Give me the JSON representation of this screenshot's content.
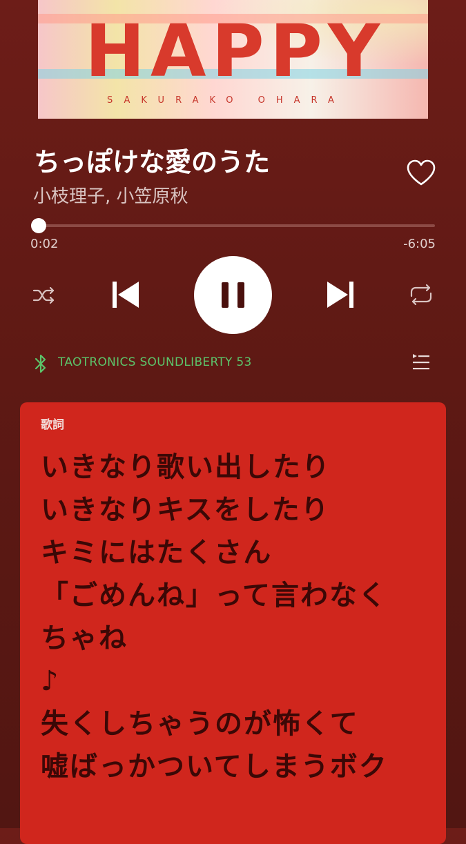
{
  "album_art": {
    "title_text": "HAPPY",
    "artist_text": "SAKURAKO OHARA"
  },
  "track": {
    "title": "ちっぽけな愛のうた",
    "artists": "小枝理子, 小笠原秋"
  },
  "playback": {
    "elapsed": "0:02",
    "remaining": "-6:05",
    "progress_fraction": 0.005
  },
  "controls": {
    "shuffle_icon": "shuffle-icon",
    "previous_icon": "skip-previous-icon",
    "play_pause_icon": "pause-icon",
    "next_icon": "skip-next-icon",
    "repeat_icon": "repeat-icon"
  },
  "device": {
    "name": "TAOTRONICS SOUNDLIBERTY 53",
    "icon": "bluetooth-icon",
    "color": "#5cc46a"
  },
  "lyrics": {
    "heading": "歌詞",
    "lines": [
      "いきなり歌い出したり",
      "いきなりキスをしたり",
      "キミにはたくさん",
      "「ごめんね」って言わなく",
      "ちゃね",
      "♪",
      "失くしちゃうのが怖くて",
      "嘘ばっかついてしまうボク"
    ],
    "card_color": "#d0261d"
  },
  "colors": {
    "background": "#6d1d18",
    "accent_green": "#5cc46a"
  }
}
